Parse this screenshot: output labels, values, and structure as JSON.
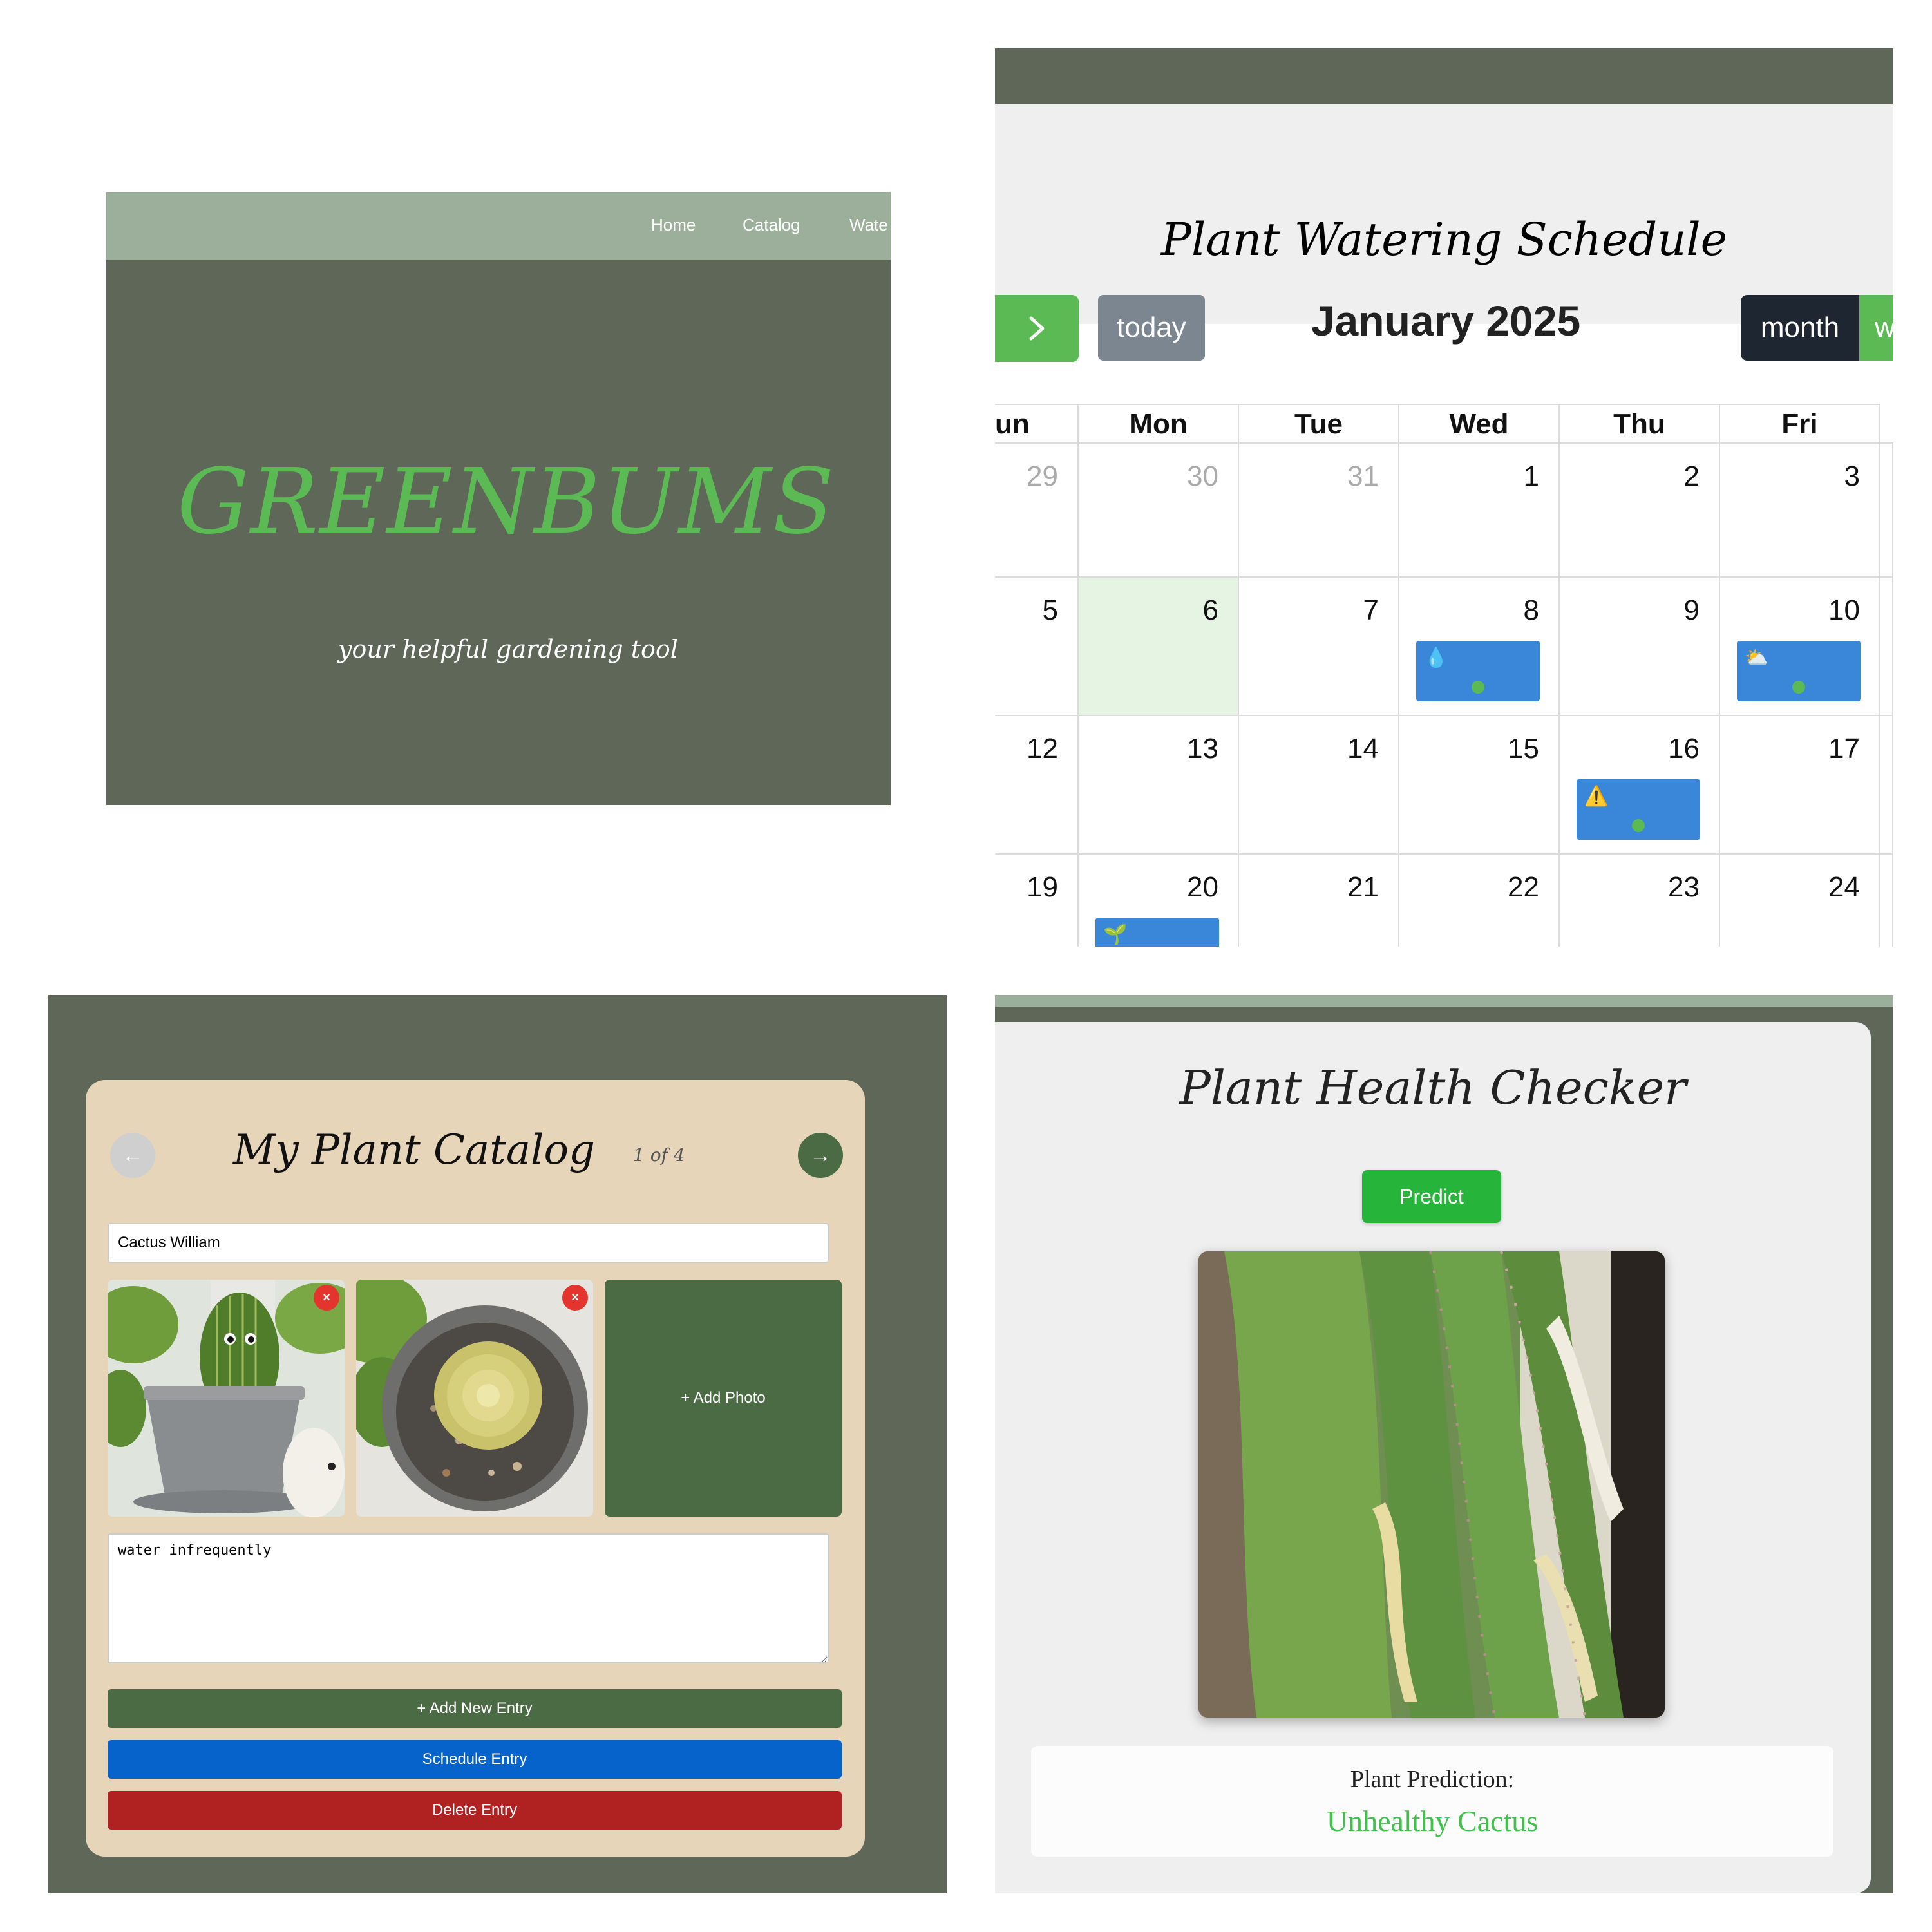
{
  "landing": {
    "nav": [
      "Home",
      "Catalog",
      "Wate"
    ],
    "brand": "GREENBUMS",
    "tagline": "your helpful gardening tool",
    "colors": {
      "header": "#9caf9a",
      "background": "#5f6759",
      "brand": "#5cba55"
    }
  },
  "calendar": {
    "heading": "Plant Watering Schedule",
    "next_icon": "chevron-right-icon",
    "today_label": "today",
    "title": "January 2025",
    "view_month": "month",
    "view_week": "w",
    "weekdays": [
      "un",
      "Mon",
      "Tue",
      "Wed",
      "Thu",
      "Fri"
    ],
    "weeks": [
      [
        {
          "n": "29",
          "muted": true
        },
        {
          "n": "30",
          "muted": true
        },
        {
          "n": "31",
          "muted": true
        },
        {
          "n": "1"
        },
        {
          "n": "2"
        },
        {
          "n": "3"
        }
      ],
      [
        {
          "n": "5"
        },
        {
          "n": "6",
          "today": true
        },
        {
          "n": "7"
        },
        {
          "n": "8",
          "event": "💧"
        },
        {
          "n": "9"
        },
        {
          "n": "10",
          "event": "⛅"
        }
      ],
      [
        {
          "n": "12"
        },
        {
          "n": "13"
        },
        {
          "n": "14"
        },
        {
          "n": "15"
        },
        {
          "n": "16",
          "event": "⚠️"
        },
        {
          "n": "17"
        }
      ],
      [
        {
          "n": "19"
        },
        {
          "n": "20",
          "event": "🌱"
        },
        {
          "n": "21"
        },
        {
          "n": "22"
        },
        {
          "n": "23"
        },
        {
          "n": "24"
        }
      ]
    ],
    "colors": {
      "event": "#3a87d9",
      "today_bg": "#e6f4e4",
      "accent": "#5cba55",
      "dark": "#1e2731"
    }
  },
  "catalog": {
    "title": "My Plant Catalog",
    "prev_icon": "arrow-left-icon",
    "next_icon": "arrow-right-icon",
    "page_indicator": "1 of 4",
    "name_value": "Cactus William",
    "photo_delete": "×",
    "add_photo_label": "+ Add Photo",
    "notes_value": "water infrequently",
    "add_entry_label": "+ Add New Entry",
    "schedule_label": "Schedule Entry",
    "delete_label": "Delete Entry",
    "colors": {
      "card": "#e6d5b8",
      "green": "#4a6b43",
      "blue": "#0763cc",
      "red": "#b02221"
    }
  },
  "health": {
    "title": "Plant Health Checker",
    "predict_label": "Predict",
    "result_label": "Plant Prediction:",
    "result_value": "Unhealthy Cactus",
    "colors": {
      "predict": "#27b43a",
      "result": "#3fc24a"
    }
  }
}
